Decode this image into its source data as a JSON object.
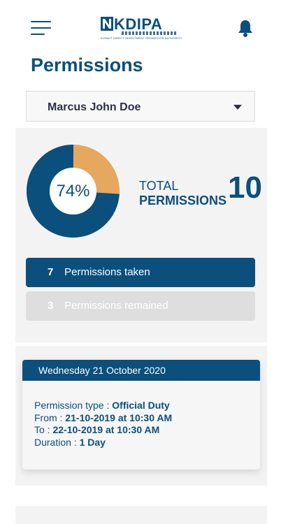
{
  "header": {
    "menu_icon": "hamburger-icon",
    "logo_text": "KDIPA",
    "logo_subtitle": "KUWAIT DIRECT INVESTMENT PROMOTION AUTHORITY",
    "notification_icon": "bell-icon"
  },
  "page": {
    "title": "Permissions"
  },
  "selector": {
    "value": "Marcus John Doe",
    "caret_icon": "caret-down-icon"
  },
  "summary": {
    "percent_label": "74%",
    "percent_value": 74,
    "total_label_1": "TOTAL",
    "total_label_2": "PERMISSIONS",
    "total_value": "10",
    "taken_count": "7",
    "taken_label": "Permissions taken",
    "remained_count": "3",
    "remained_label": "Permissions remained",
    "colors": {
      "primary": "#0b4f7c",
      "accent": "#e6a75e",
      "muted": "#dedede"
    }
  },
  "detail": {
    "date": "Wednesday 21 October 2020",
    "type_label": "Permission type : ",
    "type_value": "Official Duty",
    "from_label": "From : ",
    "from_value": "21-10-2019 at 10:30 AM",
    "to_label": "To : ",
    "to_value": "22-10-2019 at 10:30 AM",
    "duration_label": "Duration : ",
    "duration_value": "1 Day"
  }
}
